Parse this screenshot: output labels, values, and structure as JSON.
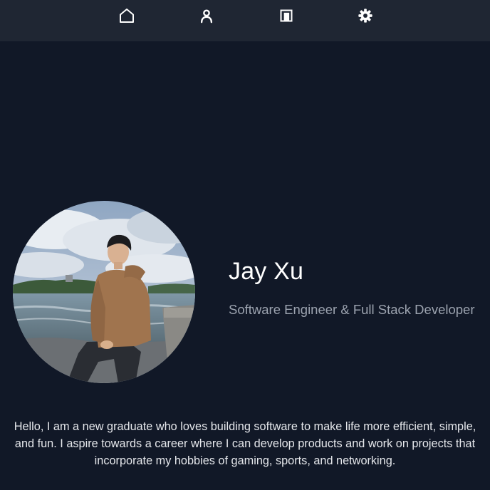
{
  "navbar": {
    "items": [
      {
        "icon": "home-icon"
      },
      {
        "icon": "user-icon"
      },
      {
        "icon": "book-icon"
      },
      {
        "icon": "gear-icon"
      }
    ],
    "icon_color": "#ffffff",
    "background": "#1f2633"
  },
  "profile": {
    "name": "Jay Xu",
    "title": "Software Engineer & Full Stack Developer"
  },
  "bio": "Hello, I am a new graduate who loves building software to make life more efficient, simple, and fun. I aspire towards a career where I can develop products and work on projects that incorporate my hobbies of gaming, sports, and networking.",
  "colors": {
    "page_background": "#111827",
    "name_text": "#ffffff",
    "title_text": "#9ca3af",
    "bio_text": "#e5e7eb"
  }
}
